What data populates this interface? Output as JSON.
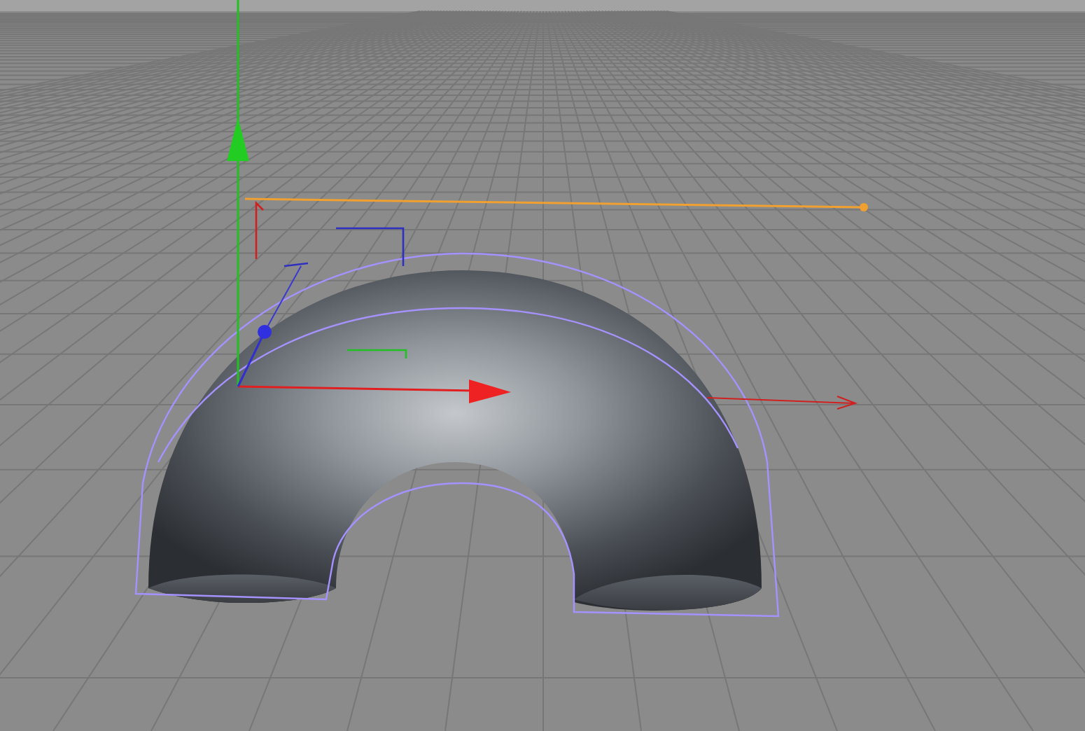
{
  "viewport": {
    "object": {
      "kind": "half-torus",
      "selected": true
    }
  }
}
